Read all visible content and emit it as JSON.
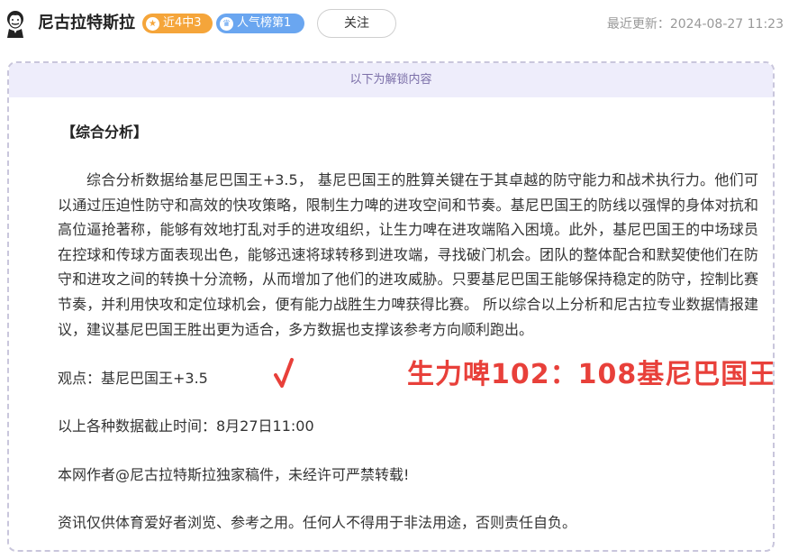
{
  "header": {
    "author_name": "尼古拉特斯拉",
    "badge_recent": "近4中3",
    "badge_popular": "人气榜第1",
    "follow_label": "关注",
    "updated_text": "最近更新：2024-08-27 11:23"
  },
  "card": {
    "unlock_text": "以下为解锁内容",
    "section_title": "【综合分析】",
    "analysis_text": "综合分析数据给基尼巴国王+3.5， 基尼巴国王的胜算关键在于其卓越的防守能力和战术执行力。他们可以通过压迫性防守和高效的快攻策略，限制生力啤的进攻空间和节奏。基尼巴国王的防线以强悍的身体对抗和高位逼抢著称，能够有效地打乱对手的进攻组织，让生力啤在进攻端陷入困境。此外，基尼巴国王的中场球员在控球和传球方面表现出色，能够迅速将球转移到进攻端，寻找破门机会。团队的整体配合和默契使他们在防守和进攻之间的转换十分流畅，从而增加了他们的进攻威胁。只要基尼巴国王能够保持稳定的防守，控制比赛节奏，并利用快攻和定位球机会，便有能力战胜生力啤获得比赛。 所以综合以上分析和尼古拉专业数据情报建议，建议基尼巴国王胜出更为适合，多方数据也支撑该参考方向顺利跑出。",
    "viewpoint": "观点：基尼巴国王+3.5",
    "final_score": "生力啤102：108基尼巴国王",
    "cutoff_time": "以上各种数据截止时间：8月27日11:00",
    "copyright": "本网作者@尼古拉特斯拉独家稿件，未经许可严禁转载!",
    "disclaimer": "资讯仅供体育爱好者浏览、参考之用。任何人不得用于非法用途，否则责任自负。"
  },
  "colors": {
    "badge_orange": "#f5a53a",
    "badge_blue": "#6aa6f0",
    "score_red": "#e8403a",
    "unlock_bg": "#eeedfb"
  },
  "icons": {
    "avatar": "tesla-portrait-avatar",
    "badge_recent": "star-icon",
    "badge_popular": "crown-icon",
    "verdict": "red-checkmark-icon"
  }
}
